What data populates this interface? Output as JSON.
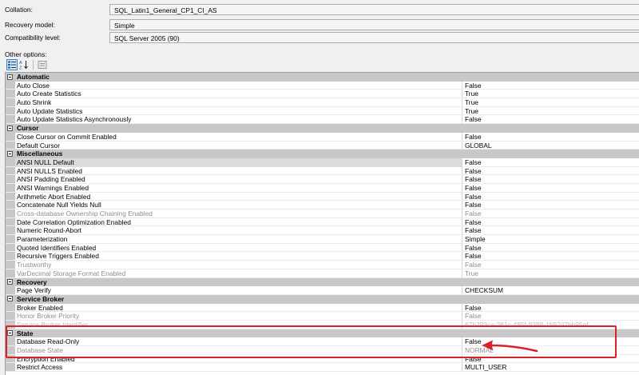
{
  "fields": [
    {
      "label": "Collation:",
      "value": "SQL_Latin1_General_CP1_CI_AS"
    },
    {
      "label": "Recovery model:",
      "value": "Simple"
    },
    {
      "label": "Compatibility level:",
      "value": "SQL Server 2005 (90)"
    }
  ],
  "other_options_label": "Other options:",
  "toolbar": {
    "categorized_icon": "categorized-icon",
    "alphabetical_icon": "alphabetical-sort-icon",
    "property_pages_icon": "property-pages-icon"
  },
  "grid": {
    "categories": [
      {
        "name": "Automatic",
        "rows": [
          {
            "name": "Auto Close",
            "value": "False"
          },
          {
            "name": "Auto Create Statistics",
            "value": "True"
          },
          {
            "name": "Auto Shrink",
            "value": "True"
          },
          {
            "name": "Auto Update Statistics",
            "value": "True"
          },
          {
            "name": "Auto Update Statistics Asynchronously",
            "value": "False"
          }
        ]
      },
      {
        "name": "Cursor",
        "rows": [
          {
            "name": "Close Cursor on Commit Enabled",
            "value": "False"
          },
          {
            "name": "Default Cursor",
            "value": "GLOBAL"
          }
        ]
      },
      {
        "name": "Miscellaneous",
        "rows": [
          {
            "name": "ANSI NULL Default",
            "value": "False",
            "selected": true
          },
          {
            "name": "ANSI NULLS Enabled",
            "value": "False"
          },
          {
            "name": "ANSI Padding Enabled",
            "value": "False"
          },
          {
            "name": "ANSI Warnings Enabled",
            "value": "False"
          },
          {
            "name": "Arithmetic Abort Enabled",
            "value": "False"
          },
          {
            "name": "Concatenate Null Yields Null",
            "value": "False"
          },
          {
            "name": "Cross-database Ownership Chaining Enabled",
            "value": "False",
            "readonly": true
          },
          {
            "name": "Date Correlation Optimization Enabled",
            "value": "False"
          },
          {
            "name": "Numeric Round-Abort",
            "value": "False"
          },
          {
            "name": "Parameterization",
            "value": "Simple"
          },
          {
            "name": "Quoted Identifiers Enabled",
            "value": "False"
          },
          {
            "name": "Recursive Triggers Enabled",
            "value": "False"
          },
          {
            "name": "Trustworthy",
            "value": "False",
            "readonly": true
          },
          {
            "name": "VarDecimal Storage Format Enabled",
            "value": "True",
            "readonly": true
          }
        ]
      },
      {
        "name": "Recovery",
        "rows": [
          {
            "name": "Page Verify",
            "value": "CHECKSUM"
          }
        ]
      },
      {
        "name": "Service Broker",
        "rows": [
          {
            "name": "Broker Enabled",
            "value": "False"
          },
          {
            "name": "Honor Broker Priority",
            "value": "False",
            "readonly": true
          },
          {
            "name": "Service Broker Identifier",
            "value": "67b293ca-261c-485f-9388-1b92d7bb95ef",
            "faded": true
          }
        ]
      },
      {
        "name": "State",
        "rows": [
          {
            "name": "Database Read-Only",
            "value": "False"
          },
          {
            "name": "Database State",
            "value": "NORMAL",
            "readonly": true
          },
          {
            "name": "Encryption Enabled",
            "value": "False"
          },
          {
            "name": "Restrict Access",
            "value": "MULTI_USER"
          }
        ]
      }
    ]
  },
  "annotation": {
    "color": "#d6232a"
  }
}
